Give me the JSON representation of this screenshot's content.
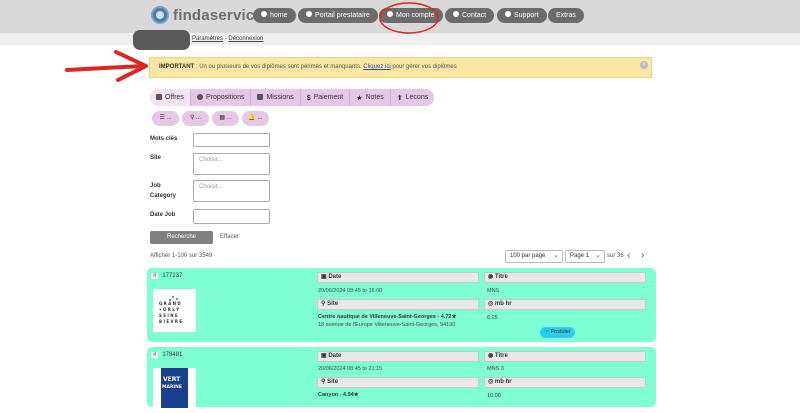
{
  "header": {
    "brand": "findaservice",
    "nav": [
      {
        "label": "home",
        "icon": "home-icon"
      },
      {
        "label": "Portail prestataire",
        "icon": "globe-icon"
      },
      {
        "label": "Mon compte",
        "icon": "gear-icon"
      },
      {
        "label": "Contact",
        "icon": "chat-icon"
      },
      {
        "label": "Support",
        "icon": "help-icon"
      },
      {
        "label": "Extras",
        "icon": ""
      }
    ]
  },
  "subheader": {
    "links": [
      "Paramètres",
      "Déconnexion"
    ],
    "separator": "-"
  },
  "alert": {
    "strong": "IMPORTANT",
    "text": " : Un ou plusieurs de vos diplômes sont périmés et manquants. ",
    "link": "Cliquez ici",
    "tail": " pour gérer vos diplômes",
    "close": "×"
  },
  "tabs": [
    {
      "label": "Offres",
      "icon": "document-icon"
    },
    {
      "label": "Propositions",
      "icon": "clock-icon"
    },
    {
      "label": "Missions",
      "icon": "check-icon"
    },
    {
      "label": "Paiement",
      "icon": "dollar-icon"
    },
    {
      "label": "Notes",
      "icon": "star-icon"
    },
    {
      "label": "Lecons",
      "icon": "graduation-icon"
    }
  ],
  "filters": [
    {
      "label": "...",
      "icon": "list-icon"
    },
    {
      "label": "...",
      "icon": "map-pin-icon"
    },
    {
      "label": "...",
      "icon": "calendar-icon"
    },
    {
      "label": "...",
      "icon": "bell-icon"
    }
  ],
  "form": {
    "keywords_label": "Mots clés",
    "site_label": "Site",
    "site_placeholder": "Choisir...",
    "job_label_line1": "Job",
    "job_label_line2": "Category",
    "job_placeholder": "Choisir...",
    "date_label": "Date Job",
    "search_button": "Recherche",
    "clear_button": "Effacer"
  },
  "pagination": {
    "results": "Afficher 1-100 sur 3549",
    "per_page": "100 par page",
    "page": "Page 1",
    "of": "sur 36",
    "prev": "‹",
    "next": "›"
  },
  "cards": [
    {
      "hash": "#",
      "id": "177237",
      "date_label": "Date",
      "date_value": "20/06/2024 08:45 to 16:00",
      "site_label": "Site",
      "site_name": "Centre nautique de Villeneuve-Saint-Georges - 4.72★",
      "site_address": "18 avenue de l'Europe Villeneuve-Saint-Georges, 94190",
      "title_label": "Titre",
      "title_value": "MNS",
      "rate_label": "mb hr",
      "rate_value": "6.25",
      "apply_label": "Postuler",
      "logo_text": "GRAND ORLY SEINE BIÈVRE"
    },
    {
      "hash": "#",
      "id": "178481",
      "date_label": "Date",
      "date_value": "20/06/2024 08:45 to 21:15",
      "site_label": "Site",
      "site_name": "Canyon - 4.94★",
      "title_label": "Titre",
      "title_value": "MNS 3",
      "rate_label": "mb hr",
      "rate_value": "10.00",
      "logo_text": "VERT MARINE"
    }
  ]
}
